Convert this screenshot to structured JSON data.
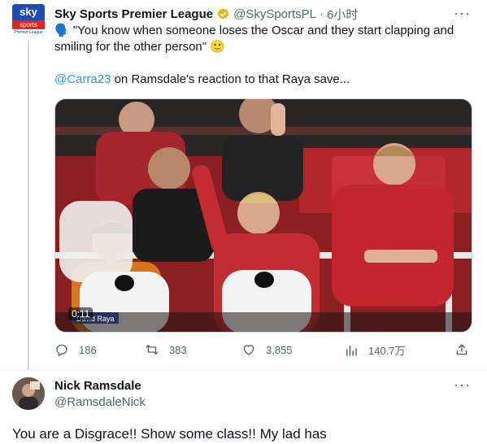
{
  "tweet": {
    "avatar": {
      "logo_top": "sky",
      "logo_mid": "sports",
      "logo_bottom": "Premier League"
    },
    "author_name": "Sky Sports Premier League",
    "handle": "@SkySportsPL",
    "separator": "·",
    "time": "6小时",
    "more": "···",
    "text_line1": "🗣️ \"You know when someone loses the Oscar and they start clapping and smiling for the other person\" 🙂",
    "mention": "@Carra23",
    "text_line2_rest": " on Ramsdale's reaction to that Raya save...",
    "media": {
      "timecode": "0:11",
      "caption_tag": "David Raya"
    },
    "actions": {
      "reply_count": "186",
      "retweet_count": "383",
      "like_count": "3,855",
      "views_count": "140.7万"
    }
  },
  "reply": {
    "author_name": "Nick Ramsdale",
    "handle": "@RamsdaleNick",
    "more": "···",
    "text": "You are a Disgrace!! Show some class!! My lad has"
  },
  "colors": {
    "accent": "#1d9bf0",
    "muted": "#536471",
    "verified_gold": "#e2b719"
  }
}
